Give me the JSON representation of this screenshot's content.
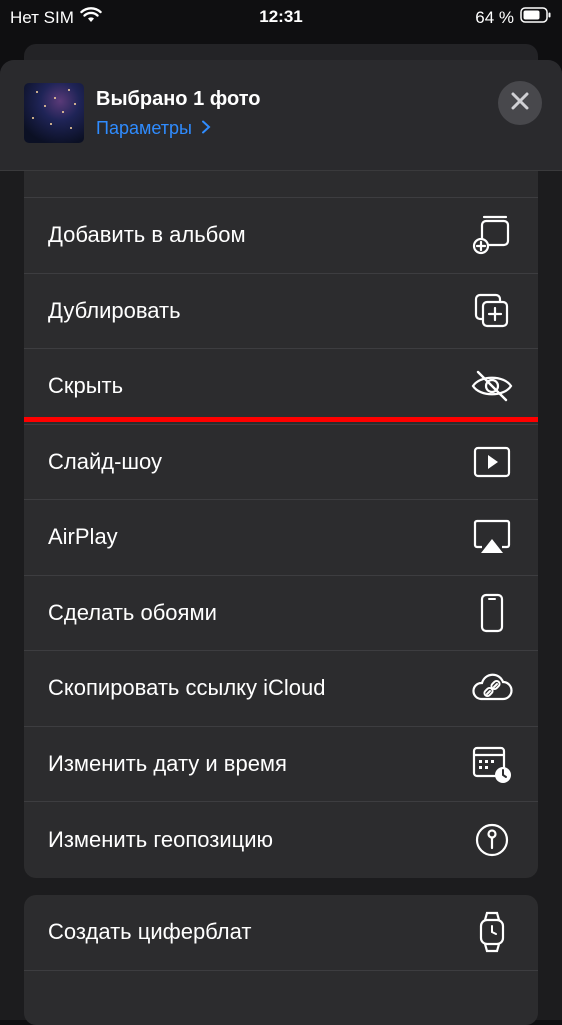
{
  "status_bar": {
    "carrier": "Нет SIM",
    "time": "12:31",
    "battery": "64 %"
  },
  "header": {
    "title": "Выбрано 1 фото",
    "options_link": "Параметры"
  },
  "actions": [
    {
      "label": "Добавить в альбом",
      "icon": "add-to-album-icon"
    },
    {
      "label": "Дублировать",
      "icon": "duplicate-icon"
    },
    {
      "label": "Скрыть",
      "icon": "hide-eye-icon"
    },
    {
      "label": "Слайд-шоу",
      "icon": "slideshow-play-icon"
    },
    {
      "label": "AirPlay",
      "icon": "airplay-icon"
    },
    {
      "label": "Сделать обоями",
      "icon": "phone-wallpaper-icon"
    },
    {
      "label": "Скопировать ссылку iCloud",
      "icon": "icloud-link-icon"
    },
    {
      "label": "Изменить дату и время",
      "icon": "calendar-clock-icon"
    },
    {
      "label": "Изменить геопозицию",
      "icon": "location-pin-icon"
    }
  ],
  "secondary_actions": [
    {
      "label": "Создать циферблат",
      "icon": "watch-icon"
    }
  ],
  "colors": {
    "accent": "#2f8cff",
    "highlight_line": "#ff0000",
    "sheet_bg": "#1c1c1e",
    "card_bg": "#2c2c2e"
  }
}
